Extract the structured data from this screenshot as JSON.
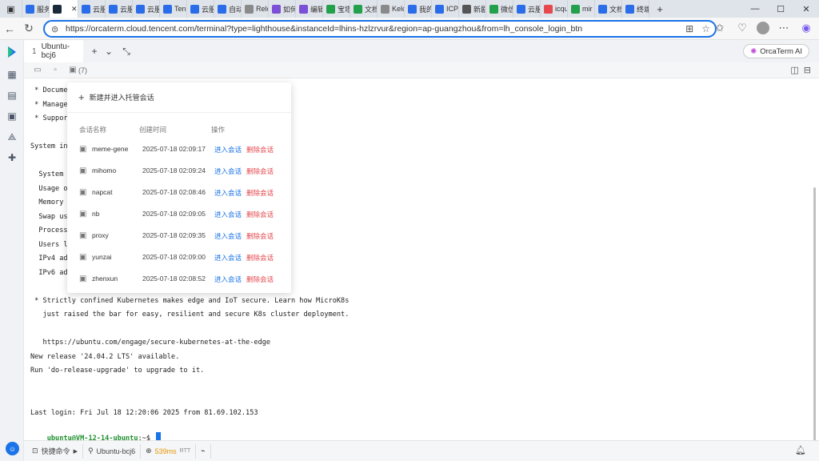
{
  "browser": {
    "tabs": [
      {
        "label": "服务",
        "color": "#2b6de8"
      },
      {
        "label": "",
        "color": "#1a2a3a",
        "active": true
      },
      {
        "label": "云服",
        "color": "#2b6de8"
      },
      {
        "label": "云服",
        "color": "#2b6de8"
      },
      {
        "label": "云服",
        "color": "#2b6de8"
      },
      {
        "label": "Ten",
        "color": "#2b6de8"
      },
      {
        "label": "云服",
        "color": "#2b6de8"
      },
      {
        "label": "自动",
        "color": "#2b6de8"
      },
      {
        "label": "Relo",
        "color": "#8a8a8a"
      },
      {
        "label": "如何",
        "color": "#7b4fd6"
      },
      {
        "label": "编辑",
        "color": "#7b4fd6"
      },
      {
        "label": "宝塔",
        "color": "#22a04b"
      },
      {
        "label": "文档",
        "color": "#22a04b"
      },
      {
        "label": "Kelo",
        "color": "#8a8a8a"
      },
      {
        "label": "我的",
        "color": "#2b6de8"
      },
      {
        "label": "ICP",
        "color": "#2b6de8"
      },
      {
        "label": "新剧",
        "color": "#555555"
      },
      {
        "label": "微信",
        "color": "#22a04b"
      },
      {
        "label": "云服",
        "color": "#2b6de8"
      },
      {
        "label": "icqu",
        "color": "#e5484d"
      },
      {
        "label": "mir",
        "color": "#22a04b"
      },
      {
        "label": "文档",
        "color": "#2b6de8"
      },
      {
        "label": "终端",
        "color": "#2b6de8"
      }
    ],
    "url": "https://orcaterm.cloud.tencent.com/terminal?type=lighthouse&instanceId=lhins-hzlzrvur&region=ap-guangzhou&from=lh_console_login_btn",
    "window_controls": [
      "—",
      "☐",
      "✕"
    ]
  },
  "app": {
    "tab": {
      "number": "1",
      "label": "Ubuntu-bcj6"
    },
    "orca_button": "OrcaTerm AI",
    "toolbar_count": "(7)"
  },
  "terminal": {
    "lines": [
      " * Documen",
      " * Managem",
      " * Support",
      "",
      "System in",
      "",
      "  System l",
      "  Usage of",
      "  Memory u",
      "  Swap usa",
      "  Processe",
      "  Users lo",
      "  IPv4 add",
      "  IPv6 add",
      "",
      " * Strictly confined Kubernetes makes edge and IoT secure. Learn how MicroK8s",
      "   just raised the bar for easy, resilient and secure K8s cluster deployment.",
      "",
      "   https://ubuntu.com/engage/secure-kubernetes-at-the-edge",
      "New release '24.04.2 LTS' available.",
      "Run 'do-release-upgrade' to upgrade to it.",
      "",
      "",
      "Last login: Fri Jul 18 12:20:06 2025 from 81.69.102.153"
    ],
    "prompt_user": "ubuntu@VM-12-14-ubuntu",
    "prompt_suffix": ":~$ "
  },
  "session_popup": {
    "new_session": "新建并进入托管会话",
    "headers": {
      "name": "会话名称",
      "created": "创建时间",
      "action": "操作"
    },
    "enter_label": "进入会话",
    "delete_label": "删除会话",
    "sessions": [
      {
        "name": "meme-gene",
        "time": "2025-07-18 02:09:17"
      },
      {
        "name": "mihomo",
        "time": "2025-07-18 02:09:24"
      },
      {
        "name": "napcat",
        "time": "2025-07-18 02:08:46"
      },
      {
        "name": "nb",
        "time": "2025-07-18 02:09:05"
      },
      {
        "name": "proxy",
        "time": "2025-07-18 02:09:35"
      },
      {
        "name": "yunzai",
        "time": "2025-07-18 02:09:00"
      },
      {
        "name": "zhenxun",
        "time": "2025-07-18 02:08:52"
      }
    ]
  },
  "statusbar": {
    "quick_cmd": "快捷命令",
    "host": "Ubuntu-bcj6",
    "latency": "539ms",
    "latency_unit": "RTT"
  },
  "colors": {
    "accent": "#1a73e8",
    "delete": "#e5484d",
    "prompt": "#1e8f2e",
    "latency": "#e69500"
  }
}
